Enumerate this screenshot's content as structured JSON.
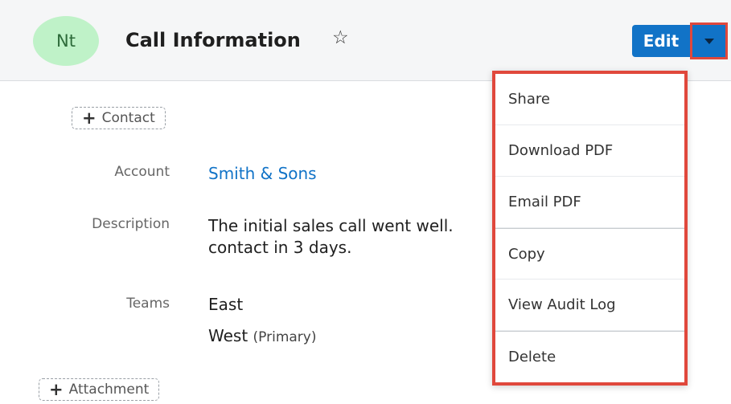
{
  "header": {
    "avatar_initials": "Nt",
    "title": "Call Information",
    "favorite_icon": "star-outline-icon",
    "edit_label": "Edit",
    "actions_icon": "caret-down-icon"
  },
  "fields": {
    "contact_button": "Contact",
    "account_label": "Account",
    "account_value": "Smith & Sons",
    "description_label": "Description",
    "description_line1": "The initial sales call went well.",
    "description_line2": "contact in 3 days.",
    "teams_label": "Teams",
    "team1": "East",
    "team2": "West",
    "team2_suffix": "(Primary)",
    "attachment_button": "Attachment"
  },
  "menu": {
    "items": [
      {
        "label": "Share"
      },
      {
        "label": "Download PDF"
      },
      {
        "label": "Email PDF"
      },
      {
        "label": "Copy"
      },
      {
        "label": "View Audit Log"
      },
      {
        "label": "Delete"
      }
    ]
  },
  "colors": {
    "accent": "#1173c7",
    "highlight": "#e0483c",
    "avatar_bg": "#bff2c8"
  }
}
